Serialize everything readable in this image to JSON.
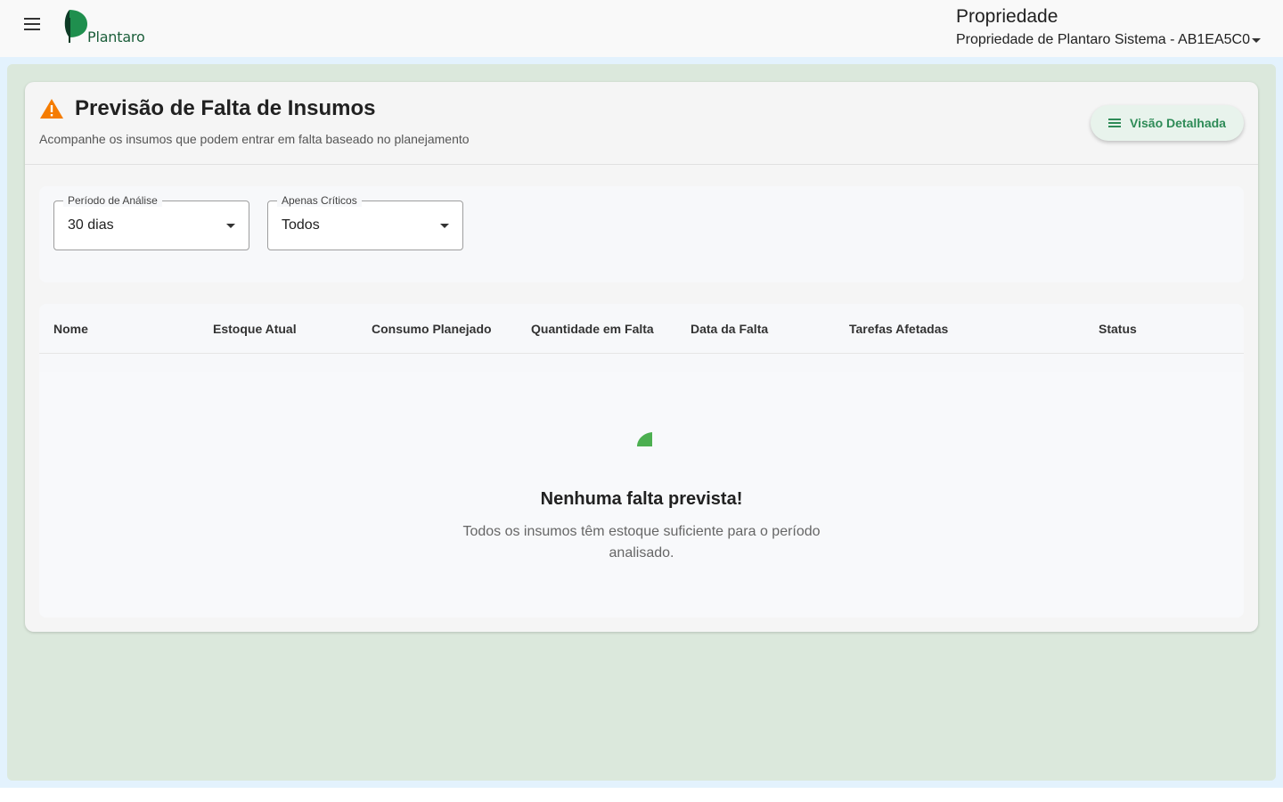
{
  "app": {
    "logo_text": "Plantaro"
  },
  "property": {
    "label": "Propriedade",
    "selected": "Propriedade de Plantaro Sistema - AB1EA5C0"
  },
  "page": {
    "title": "Previsão de Falta de Insumos",
    "subtitle": "Acompanhe os insumos que podem entrar em falta baseado no planejamento",
    "detail_button": "Visão Detalhada"
  },
  "filters": {
    "period": {
      "label": "Período de Análise",
      "value": "30 dias"
    },
    "critical": {
      "label": "Apenas Críticos",
      "value": "Todos"
    }
  },
  "table": {
    "columns": [
      "Nome",
      "Estoque Atual",
      "Consumo Planejado",
      "Quantidade em Falta",
      "Data da Falta",
      "Tarefas Afetadas",
      "Status"
    ],
    "rows": []
  },
  "empty_state": {
    "title": "Nenhuma falta prevista!",
    "message": "Todos os insumos têm estoque suficiente para o período analisado."
  },
  "colors": {
    "accent": "#2e8b57",
    "warning": "#f57c00",
    "background": "#dbe8dc"
  },
  "icons": {
    "menu": "menu-icon",
    "warning": "warning-icon",
    "list": "list-icon",
    "leaf": "leaf-icon"
  }
}
